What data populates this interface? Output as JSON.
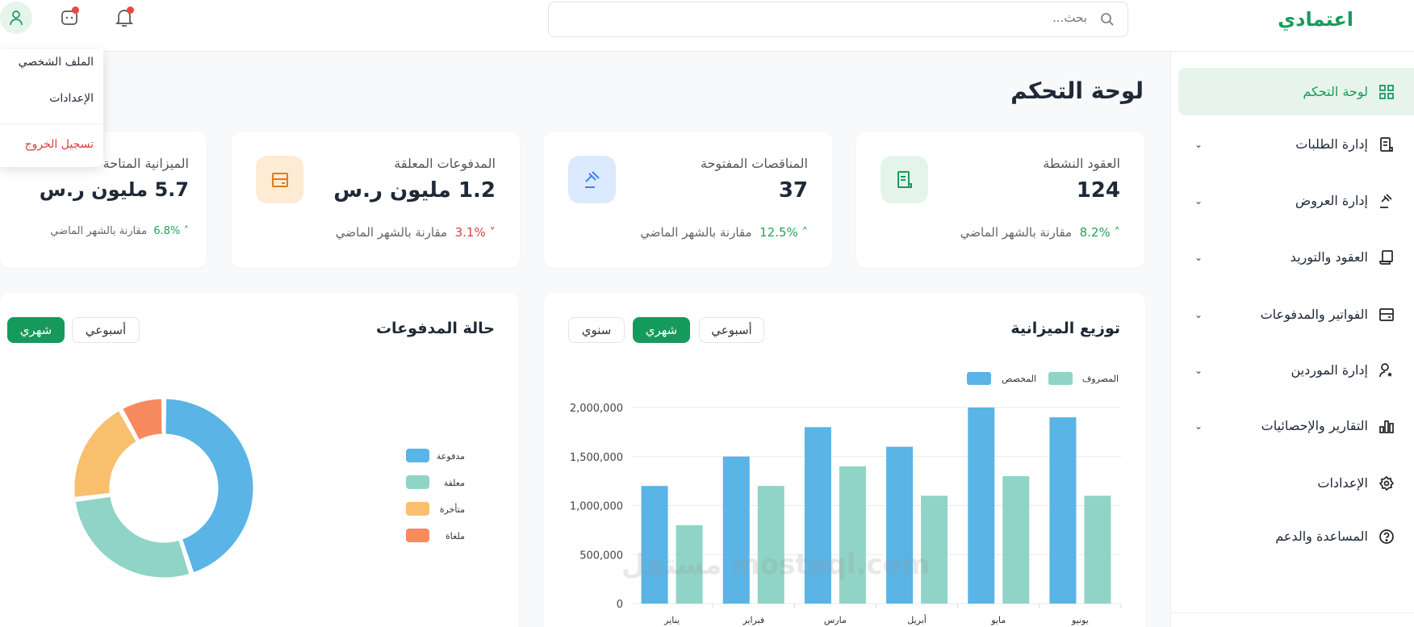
{
  "header": {
    "logo": "اعتمادي",
    "search_placeholder": "بحث..."
  },
  "user_menu": {
    "items": [
      "الملف الشخصي",
      "الإعدادات"
    ],
    "logout": "تسجيل الخروج"
  },
  "sidebar": {
    "items": [
      {
        "label": "لوحة التحكم",
        "icon": "dashboard-grid-icon",
        "active": true,
        "expandable": false
      },
      {
        "label": "إدارة الطلبات",
        "icon": "receipt-icon",
        "expandable": true
      },
      {
        "label": "إدارة العروض",
        "icon": "gavel-icon",
        "expandable": true
      },
      {
        "label": "العقود والتوريد",
        "icon": "scroll-icon",
        "expandable": true
      },
      {
        "label": "الفواتير والمدفوعات",
        "icon": "wallet-icon",
        "expandable": true
      },
      {
        "label": "إدارة الموردين",
        "icon": "user-star-icon",
        "expandable": true
      },
      {
        "label": "التقارير والإحصائيات",
        "icon": "bar-chart-icon",
        "expandable": true
      },
      {
        "label": "الإعدادات",
        "icon": "gear-icon",
        "expandable": false
      },
      {
        "label": "المساعدة والدعم",
        "icon": "help-circle-icon",
        "expandable": false
      }
    ]
  },
  "page_title": "لوحة التحكم",
  "stats": [
    {
      "label": "العقود النشطة",
      "value": "124",
      "change": "8.2%",
      "direction": "up",
      "comparison": "مقارنة بالشهر الماضي"
    },
    {
      "label": "المناقصات المفتوحة",
      "value": "37",
      "change": "12.5%",
      "direction": "up",
      "comparison": "مقارنة بالشهر الماضي"
    },
    {
      "label": "المدفوعات المعلقة",
      "value": "1.2 مليون ر.س",
      "change": "3.1%",
      "direction": "down",
      "comparison": "مقارنة بالشهر الماضي"
    },
    {
      "label": "الميزانية المتاحة",
      "value": "5.7 مليون ر.س",
      "change": "6.8%",
      "direction": "up",
      "comparison": "مقارنة بالشهر الماضي"
    }
  ],
  "budget_card": {
    "title": "توزيع الميزانية",
    "periods": [
      "أسبوعي",
      "شهري",
      "سنوي"
    ],
    "selected": "شهري"
  },
  "payments_card": {
    "title": "حالة المدفوعات",
    "periods": [
      "أسبوعي",
      "شهري"
    ],
    "selected": "شهري"
  },
  "watermark": "مستقل mostaql.com",
  "colors": {
    "accent": "#169a5c",
    "allocated": "#5ab4e6",
    "spent": "#8fd4c6",
    "late": "#f8bf6e",
    "cancelled": "#f78a5e"
  },
  "chart_data": [
    {
      "type": "bar",
      "title": "توزيع الميزانية",
      "categories": [
        "يناير",
        "فبراير",
        "مارس",
        "أبريل",
        "مايو",
        "يونيو"
      ],
      "series": [
        {
          "name": "المخصص",
          "values": [
            1200000,
            1500000,
            1800000,
            1600000,
            2000000,
            1900000
          ]
        },
        {
          "name": "المصروف",
          "values": [
            800000,
            1200000,
            1400000,
            1100000,
            1300000,
            1100000
          ]
        }
      ],
      "ylim": [
        0,
        2000000
      ],
      "yticks": [
        "0",
        "500,000",
        "1,000,000",
        "1,500,000",
        "2,000,000"
      ],
      "grid": true,
      "legend": "top-right"
    },
    {
      "type": "pie",
      "title": "حالة المدفوعات",
      "labels": [
        "مدفوعة",
        "معلقة",
        "متأخرة",
        "ملغاة"
      ],
      "values": [
        45,
        28,
        19,
        8
      ],
      "legend": "right"
    }
  ]
}
